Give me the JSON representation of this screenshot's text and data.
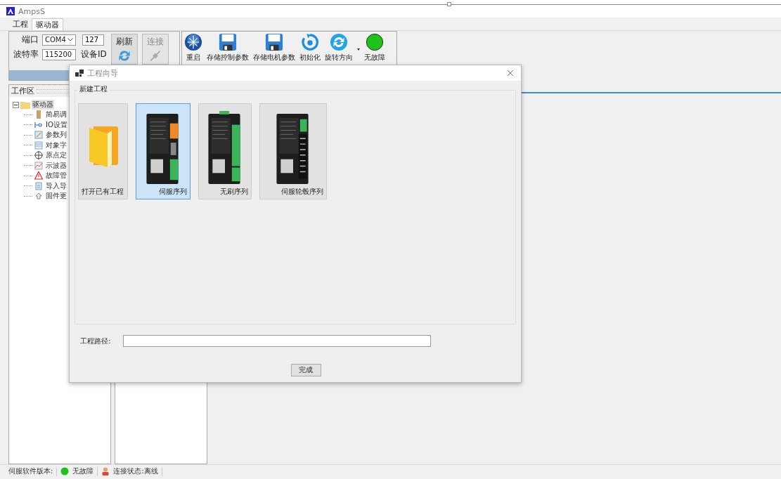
{
  "window": {
    "title": "AmpsS"
  },
  "tabs": [
    {
      "label": "工程",
      "selected": false
    },
    {
      "label": "驱动器",
      "selected": true
    }
  ],
  "connection": {
    "port_label": "端口",
    "port_value": "COM4",
    "id_value": "127",
    "baud_label": "波特率",
    "baud_value": "115200",
    "id_label": "设备ID",
    "refresh": "刷新",
    "connect": "连接",
    "connect_disabled": true
  },
  "toolbar": [
    {
      "label": "重启",
      "kind": "restart"
    },
    {
      "label": "存储控制参数",
      "kind": "save"
    },
    {
      "label": "存储电机参数",
      "kind": "save"
    },
    {
      "label": "初始化",
      "kind": "init"
    },
    {
      "label": "旋转方向",
      "kind": "rotate"
    },
    {
      "label": "无故障",
      "kind": "status",
      "fault": false
    }
  ],
  "workspace": {
    "title": "工作区",
    "tree": [
      {
        "label": "驱动器",
        "expanded": true,
        "selected": true,
        "children": [
          {
            "label": "简易调",
            "kind": "note",
            "selected": false
          },
          {
            "label": "IO设置",
            "kind": "io",
            "selected": false
          },
          {
            "label": "参数列",
            "kind": "params",
            "selected": false
          },
          {
            "label": "对象字",
            "kind": "table",
            "selected": false
          },
          {
            "label": "原点定",
            "kind": "origin",
            "selected": false
          },
          {
            "label": "示波器",
            "kind": "scope",
            "selected": false
          },
          {
            "label": "故障管",
            "kind": "warning",
            "selected": false
          },
          {
            "label": "导入导",
            "kind": "import",
            "selected": false
          },
          {
            "label": "固件更",
            "kind": "firmware",
            "selected": false
          }
        ]
      }
    ]
  },
  "dialog": {
    "title": "工程向导",
    "group": "新建工程",
    "options": [
      {
        "label": "打开已有工程",
        "kind": "folder",
        "selected": false
      },
      {
        "label": "伺服序列",
        "kind": "servo",
        "selected": true
      },
      {
        "label": "无刷序列",
        "kind": "brushless",
        "selected": false
      },
      {
        "label": "伺服轮毂序列",
        "kind": "hub",
        "selected": false
      }
    ],
    "path_label": "工程路径:",
    "finish": "完成"
  },
  "status_bar": {
    "version_label": "伺服软件版本:",
    "fault_text": "无故障",
    "fault": false,
    "connection_text": "连接状态:离线"
  }
}
